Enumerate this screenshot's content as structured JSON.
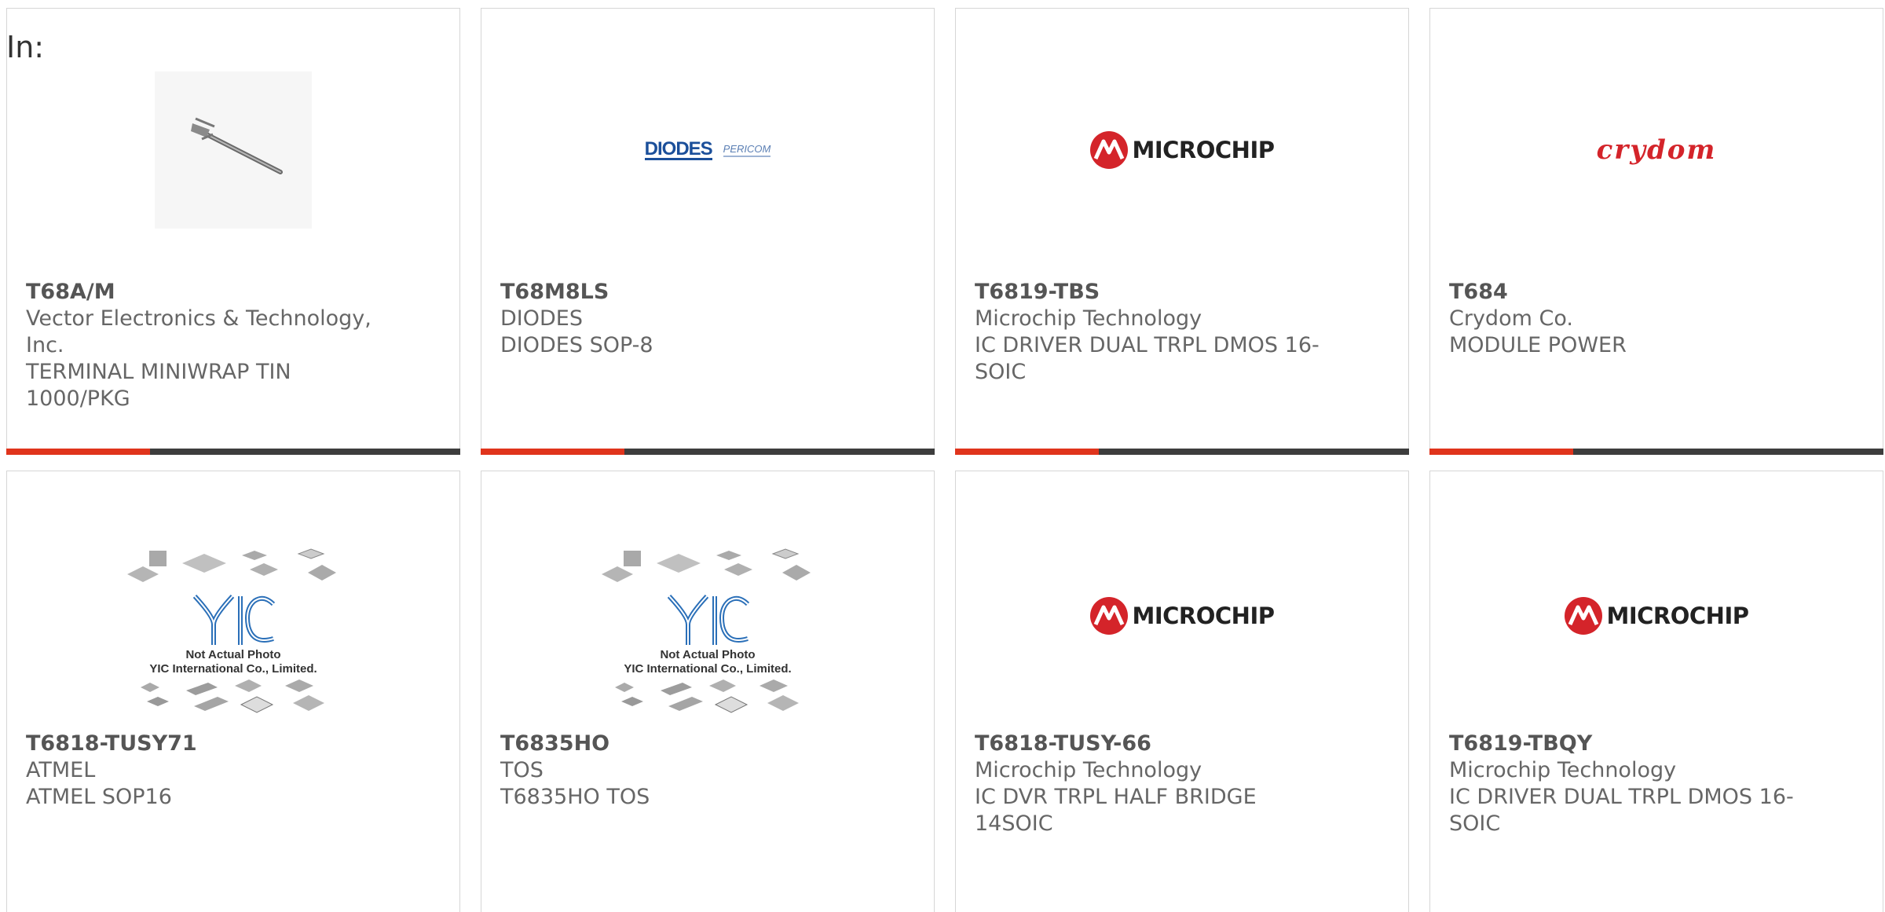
{
  "header": {
    "in_label": "In:"
  },
  "cards": [
    {
      "part_number": "T68A/M",
      "manufacturer_lines": [
        "Vector Electronics & Technology,",
        "Inc."
      ],
      "description_lines": [
        "TERMINAL MINIWRAP TIN",
        "1000/PKG"
      ],
      "image": "terminal-pin-photo"
    },
    {
      "part_number": "T68M8LS",
      "manufacturer_lines": [
        "DIODES"
      ],
      "description_lines": [
        "DIODES SOP-8"
      ],
      "image": "diodes-logo",
      "logo_text": "DIODES",
      "logo_subtext": "PERICOM"
    },
    {
      "part_number": "T6819-TBS",
      "manufacturer_lines": [
        "Microchip Technology"
      ],
      "description_lines": [
        "IC DRIVER DUAL TRPL DMOS 16-",
        "SOIC"
      ],
      "image": "microchip-logo",
      "logo_text": "MICROCHIP"
    },
    {
      "part_number": "T684",
      "manufacturer_lines": [
        "Crydom Co."
      ],
      "description_lines": [
        "MODULE POWER"
      ],
      "image": "crydom-logo",
      "logo_text": "crydom"
    },
    {
      "part_number": "T6818-TUSY71",
      "manufacturer_lines": [
        "ATMEL"
      ],
      "description_lines": [
        "ATMEL SOP16"
      ],
      "image": "yic-placeholder",
      "caption_lines": [
        "Not Actual Photo",
        "YIC International Co., Limited."
      ]
    },
    {
      "part_number": "T6835HO",
      "manufacturer_lines": [
        "TOS"
      ],
      "description_lines": [
        "T6835HO TOS"
      ],
      "image": "yic-placeholder",
      "caption_lines": [
        "Not Actual Photo",
        "YIC International Co., Limited."
      ]
    },
    {
      "part_number": "T6818-TUSY-66",
      "manufacturer_lines": [
        "Microchip Technology"
      ],
      "description_lines": [
        "IC DVR TRPL HALF BRIDGE",
        "14SOIC"
      ],
      "image": "microchip-logo",
      "logo_text": "MICROCHIP"
    },
    {
      "part_number": "T6819-TBQY",
      "manufacturer_lines": [
        "Microchip Technology"
      ],
      "description_lines": [
        "IC DRIVER DUAL TRPL DMOS 16-",
        "SOIC"
      ],
      "image": "microchip-logo",
      "logo_text": "MICROCHIP"
    }
  ],
  "colors": {
    "accent": "#e0341c",
    "bar": "#3d3d3d",
    "microchip_red": "#d4242a",
    "crydom_red": "#d4242a",
    "diodes_blue": "#1b4f9a",
    "yic_blue": "#2a6fb8"
  }
}
